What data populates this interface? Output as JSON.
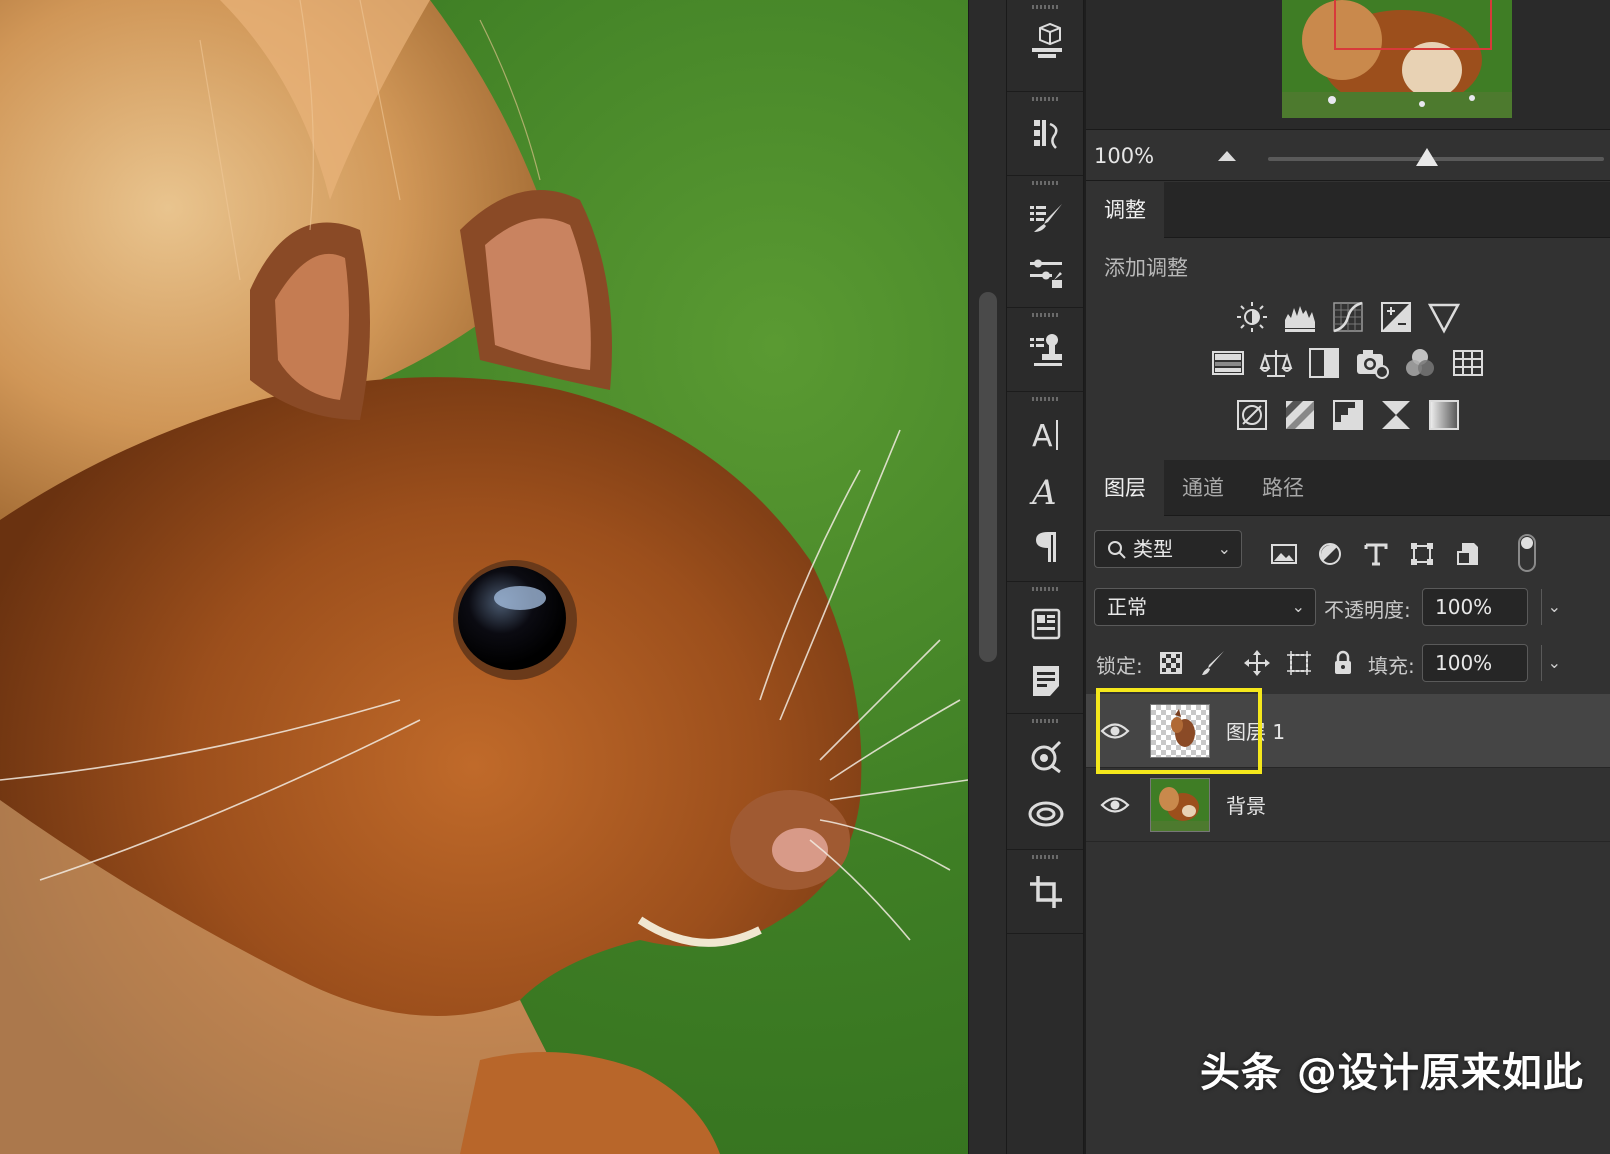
{
  "navigator": {
    "zoom_value": "100%"
  },
  "adjustments": {
    "tab_label": "调整",
    "section_title": "添加调整",
    "row1": [
      "brightness-contrast-icon",
      "levels-icon",
      "curves-icon",
      "exposure-icon",
      "vibrance-icon"
    ],
    "row2": [
      "hue-saturation-icon",
      "color-balance-icon",
      "black-white-icon",
      "photo-filter-icon",
      "channel-mixer-icon",
      "color-lookup-icon"
    ],
    "row3": [
      "invert-icon",
      "posterize-icon",
      "threshold-icon",
      "selective-color-icon",
      "gradient-map-icon"
    ]
  },
  "layers_panel": {
    "tabs": [
      "图层",
      "通道",
      "路径"
    ],
    "filter_label": "类型",
    "blend_mode": "正常",
    "opacity_label": "不透明度:",
    "opacity_value": "100%",
    "lock_label": "锁定:",
    "fill_label": "填充:",
    "fill_value": "100%",
    "layers": [
      {
        "name": "图层 1",
        "visible": true,
        "selected": true
      },
      {
        "name": "背景",
        "visible": true,
        "selected": false
      }
    ]
  },
  "watermark": "头条 @设计原来如此",
  "colors": {
    "panel_bg": "#323232",
    "highlight": "#f5e81c",
    "nav_box": "#d83a3a"
  }
}
